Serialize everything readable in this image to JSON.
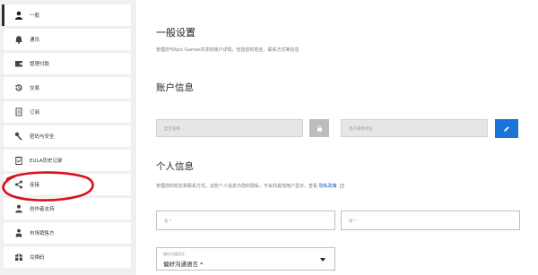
{
  "sidebar": {
    "items": [
      {
        "label": "一般",
        "icon": "person-icon",
        "active": true
      },
      {
        "label": "通讯",
        "icon": "bell-icon"
      },
      {
        "label": "管理付款",
        "icon": "wallet-icon"
      },
      {
        "label": "交易",
        "icon": "history-icon"
      },
      {
        "label": "订阅",
        "icon": "document-icon"
      },
      {
        "label": "密码与安全",
        "icon": "key-icon"
      },
      {
        "label": "EULA历史记录",
        "icon": "clipboard-icon"
      },
      {
        "label": "连接",
        "icon": "share-icon"
      },
      {
        "label": "创作者支持",
        "icon": "creator-icon"
      },
      {
        "label": "市场销售方",
        "icon": "seller-icon"
      },
      {
        "label": "兑换码",
        "icon": "redeem-icon"
      }
    ]
  },
  "main": {
    "general_title": "一般设置",
    "general_desc": "管理您与Epic Games共享的账户详情，包括您的姓名、联系方式等信息",
    "account_title": "账户信息",
    "display_name_placeholder": "显示名称",
    "email_placeholder": "电子邮件地址",
    "personal_title": "个人信息",
    "personal_desc_prefix": "管理您的姓名和联系方式。这些个人信息为您的隐私，不会向其他用户显示。查看",
    "privacy_link": "隐私政策",
    "first_name_placeholder": "名 *",
    "last_name_placeholder": "姓 *",
    "language_label": "偏好沟通语言",
    "language_value": "偏好沟通语言 *"
  },
  "colors": {
    "accent": "#1a73d9",
    "annotation_red": "#d9111b"
  }
}
